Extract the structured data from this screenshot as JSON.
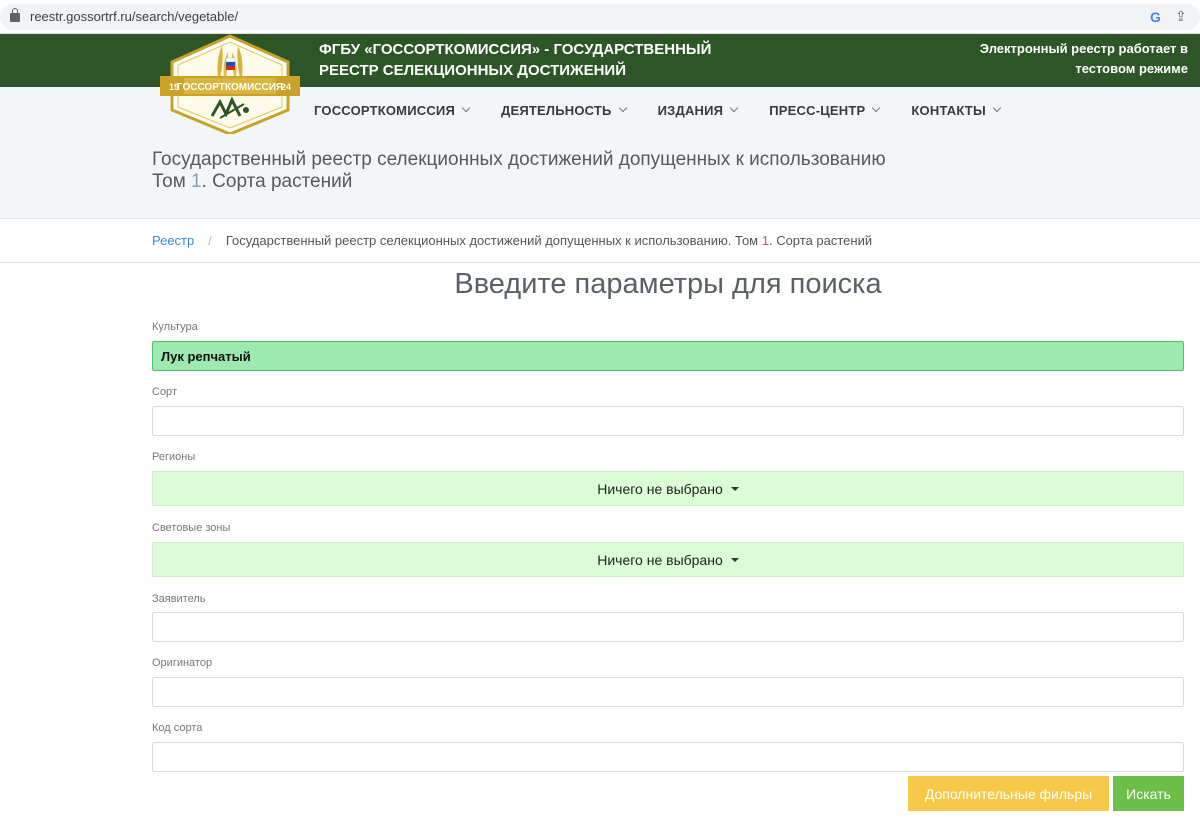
{
  "browser": {
    "url": "reestr.gossortrf.ru/search/vegetable/",
    "google_icon": "G",
    "share_icon": "⇪"
  },
  "header": {
    "org_title_line1": "ФГБУ «ГОССОРТКОМИССИЯ» - ГОСУДАРСТВЕННЫЙ",
    "org_title_line2": "РЕЕСТР СЕЛЕКЦИОННЫХ ДОСТИЖЕНИЙ",
    "test_note_line1": "Электронный реестр работает в",
    "test_note_line2": "тестовом режиме",
    "logo_text": "ГОССОРТКОМИССИЯ",
    "logo_year_left": "19",
    "logo_year_right": "24",
    "colors": {
      "header_bg": "#2e5528",
      "logo_gold": "#c9a227"
    }
  },
  "nav": {
    "items": [
      {
        "label": "ГОССОРТКОМИССИЯ"
      },
      {
        "label": "ДЕЯТЕЛЬНОСТЬ"
      },
      {
        "label": "ИЗДАНИЯ"
      },
      {
        "label": "ПРЕСС-ЦЕНТР"
      },
      {
        "label": "КОНТАКТЫ"
      }
    ]
  },
  "page": {
    "heading_line1": "Государственный реестр селекционных достижений допущенных к использованию",
    "heading_line2_prefix": "Том ",
    "heading_line2_num": "1",
    "heading_line2_suffix": ". Сорта растений"
  },
  "breadcrumb": {
    "home": "Реестр",
    "separator": "/",
    "current_prefix": "Государственный реестр селекционных достижений допущенных к использованию. Том ",
    "current_num": "1",
    "current_suffix": ". Сорта растений"
  },
  "form": {
    "title": "Введите параметры для поиска",
    "culture_label": "Культура",
    "culture_value": "Лук репчатый",
    "variety_label": "Сорт",
    "variety_value": "",
    "regions_label": "Регионы",
    "regions_value": "Ничего не выбрано",
    "light_zones_label": "Световые зоны",
    "light_zones_value": "Ничего не выбрано",
    "applicant_label": "Заявитель",
    "applicant_value": "",
    "originator_label": "Оригинатор",
    "originator_value": "",
    "variety_code_label": "Код сорта",
    "variety_code_value": "",
    "filters_button": "Дополнительные фильры",
    "search_button": "Искать"
  }
}
